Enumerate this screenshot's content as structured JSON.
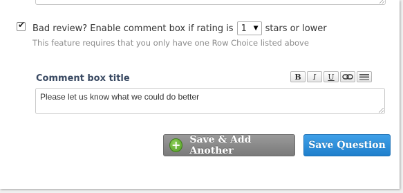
{
  "bad_review": {
    "checked": true,
    "label_before": "Bad review? Enable comment box if rating is",
    "rating_value": "1",
    "label_after": "stars or lower",
    "hint": "This feature requires that you only have one Row Choice listed above"
  },
  "comment_box": {
    "title": "Comment box title",
    "value": "Please let us know what we could do better",
    "toolbar": {
      "bold": "B",
      "italic": "I",
      "underline": "U",
      "link_icon": "link-icon",
      "align_icon": "justify-icon"
    }
  },
  "actions": {
    "save_add_another": "Save & Add Another",
    "save_question": "Save Question"
  },
  "colors": {
    "save_question_bg": "#2a8ad8",
    "save_add_bg": "#8a8a8a",
    "plus_icon": "#5aa52b",
    "title_text": "#3a4a63"
  }
}
